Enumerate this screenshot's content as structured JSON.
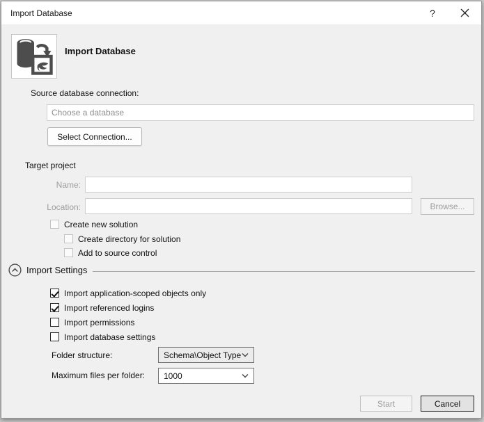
{
  "window": {
    "title": "Import Database",
    "help_glyph": "?"
  },
  "header": {
    "title": "Import Database"
  },
  "source": {
    "label": "Source database connection:",
    "input_placeholder": "Choose a database",
    "input_value": "",
    "select_connection_button": "Select Connection..."
  },
  "target": {
    "section_label": "Target project",
    "name_label": "Name:",
    "name_value": "",
    "location_label": "Location:",
    "location_value": "",
    "browse_button": "Browse...",
    "checkboxes": [
      {
        "label": "Create new solution",
        "checked": false,
        "enabled": false
      },
      {
        "label": "Create directory for solution",
        "checked": false,
        "enabled": false
      },
      {
        "label": "Add to source control",
        "checked": false,
        "enabled": false
      }
    ]
  },
  "import_settings": {
    "section_label": "Import Settings",
    "expanded": true,
    "checkboxes": [
      {
        "label": "Import application-scoped objects only",
        "checked": true,
        "enabled": true
      },
      {
        "label": "Import referenced logins",
        "checked": true,
        "enabled": true
      },
      {
        "label": "Import permissions",
        "checked": false,
        "enabled": true
      },
      {
        "label": "Import database settings",
        "checked": false,
        "enabled": true
      }
    ],
    "folder_structure_label": "Folder structure:",
    "folder_structure_value": "Schema\\Object Type",
    "max_files_label": "Maximum files per folder:",
    "max_files_value": "1000"
  },
  "footer": {
    "start_button": "Start",
    "cancel_button": "Cancel"
  },
  "icons": {
    "help": "?",
    "close": "✕",
    "expander": "chevron-up-circle",
    "dropdown_chevron": "chevron-down",
    "header_icon": "import-database"
  },
  "colors": {
    "body_bg": "#f0f0f0",
    "titlebar_bg": "#ffffff",
    "window_border": "#999999",
    "icon_color": "#4d4d4d",
    "disabled_text": "#9d9d9d"
  }
}
